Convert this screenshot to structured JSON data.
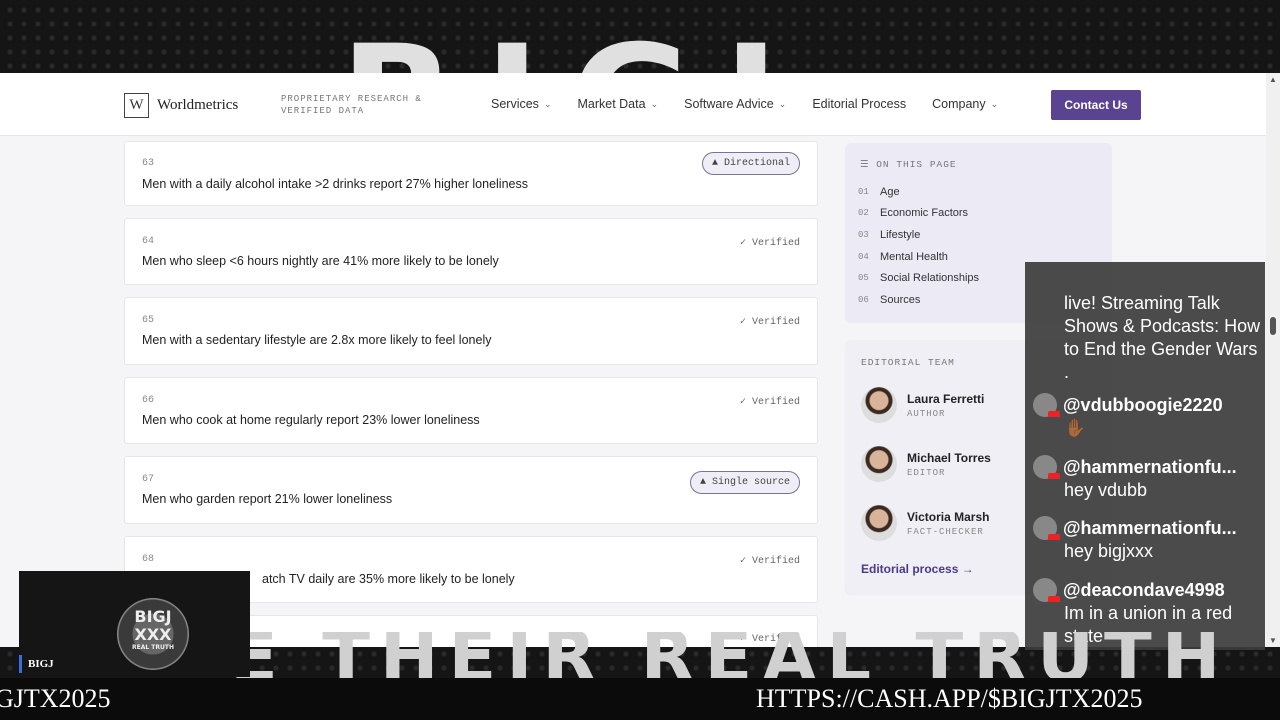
{
  "stream": {
    "top_logo": "BIGJ",
    "banner": "E THEIR REAL TRUTH",
    "cam_logo": "BIGJ XXX",
    "cam_logo_sub": "REAL TRUTH",
    "cam_tag": "BIGJ",
    "ticker_left": "GJTX2025",
    "ticker_right": "HTTPS://CASH.APP/$BIGJTX2025"
  },
  "header": {
    "brand_letter": "W",
    "brand_name": "Worldmetrics",
    "tagline": "PROPRIETARY RESEARCH & VERIFIED DATA",
    "nav": [
      {
        "label": "Services",
        "dropdown": true
      },
      {
        "label": "Market Data",
        "dropdown": true
      },
      {
        "label": "Software Advice",
        "dropdown": true
      },
      {
        "label": "Editorial Process",
        "dropdown": false
      },
      {
        "label": "Company",
        "dropdown": true
      }
    ],
    "contact_label": "Contact Us"
  },
  "stats": [
    {
      "num": "63",
      "text": "Men with a daily alcohol intake >2 drinks report 27% higher loneliness",
      "badge": "Directional",
      "badge_icon": "triangle-icon"
    },
    {
      "num": "64",
      "text": "Men who sleep <6 hours nightly are 41% more likely to be lonely",
      "badge": "Verified",
      "badge_icon": "check-icon"
    },
    {
      "num": "65",
      "text": "Men with a sedentary lifestyle are 2.8x more likely to feel lonely",
      "badge": "Verified",
      "badge_icon": "check-icon"
    },
    {
      "num": "66",
      "text": "Men who cook at home regularly report 23% lower loneliness",
      "badge": "Verified",
      "badge_icon": "check-icon"
    },
    {
      "num": "67",
      "text": "Men who garden report 21% lower loneliness",
      "badge": "Single source",
      "badge_icon": "triangle-icon"
    },
    {
      "num": "68",
      "text": "atch TV daily are 35% more likely to be lonely",
      "badge": "Verified",
      "badge_icon": "check-icon"
    },
    {
      "num": "",
      "text": "",
      "badge": "Verified",
      "badge_icon": "check-icon"
    }
  ],
  "toc": {
    "heading": "ON THIS PAGE",
    "items": [
      {
        "n": "01",
        "label": "Age"
      },
      {
        "n": "02",
        "label": "Economic Factors"
      },
      {
        "n": "03",
        "label": "Lifestyle"
      },
      {
        "n": "04",
        "label": "Mental Health"
      },
      {
        "n": "05",
        "label": "Social Relationships"
      },
      {
        "n": "06",
        "label": "Sources"
      }
    ]
  },
  "team": {
    "heading": "EDITORIAL TEAM",
    "members": [
      {
        "name": "Laura Ferretti",
        "role": "AUTHOR"
      },
      {
        "name": "Michael Torres",
        "role": "EDITOR"
      },
      {
        "name": "Victoria Marsh",
        "role": "FACT-CHECKER"
      }
    ],
    "link": "Editorial process →"
  },
  "chat": [
    {
      "user": "",
      "text": "live! Streaming Talk Shows & Podcasts: How to End the Gender Wars ."
    },
    {
      "user": "@vdubboogie2220",
      "text": "✋🏾"
    },
    {
      "user": "@hammernationfu...",
      "text": "hey vdubb"
    },
    {
      "user": "@hammernationfu...",
      "text": "hey bigjxxx"
    },
    {
      "user": "@deacondave4998",
      "text": "Im in a union in a red state"
    }
  ]
}
